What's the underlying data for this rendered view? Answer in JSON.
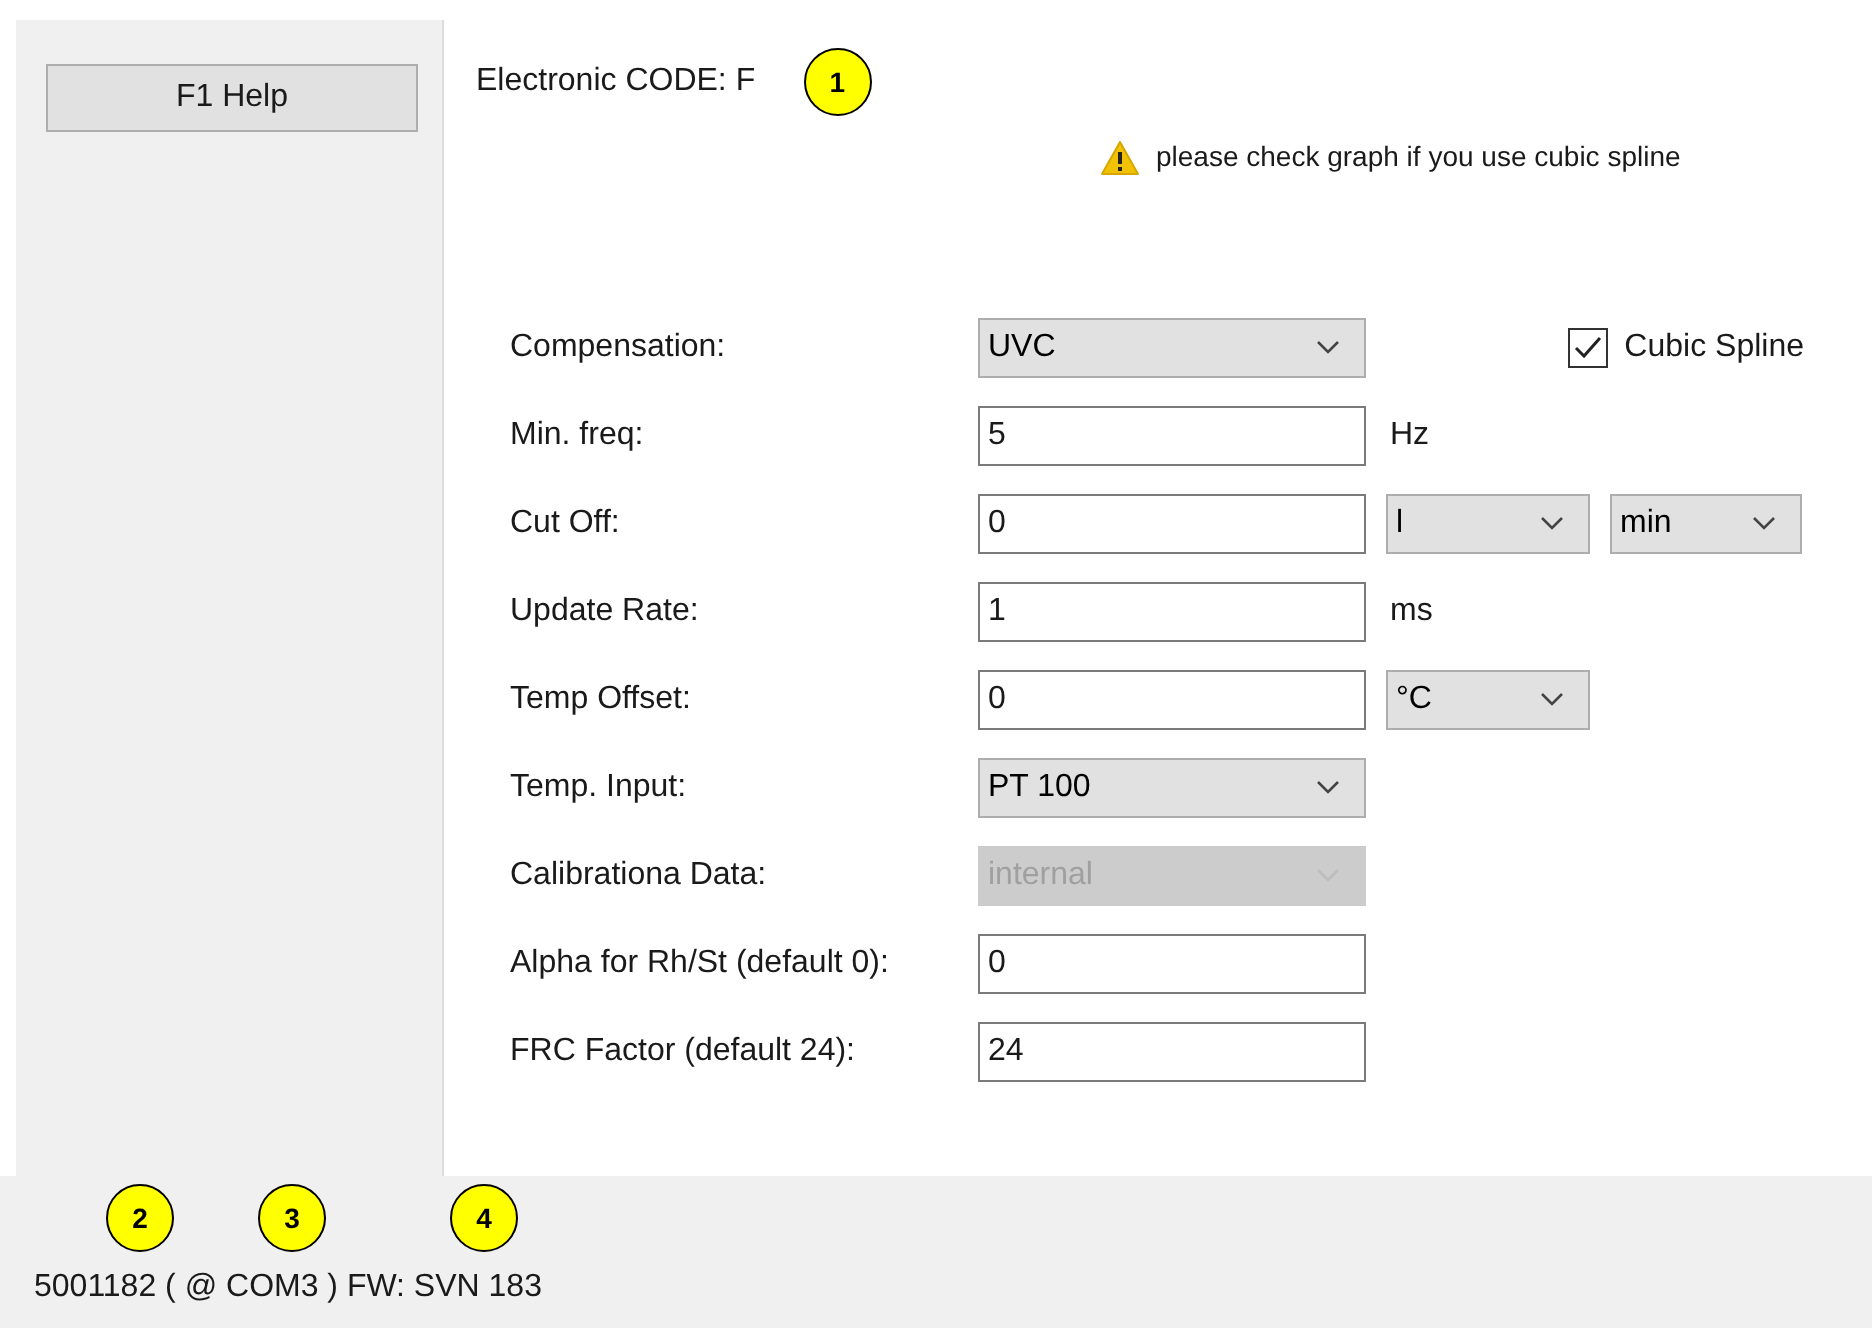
{
  "sidebar": {
    "help_button": "F1 Help"
  },
  "header": {
    "title": "Electronic CODE: F",
    "callout": "1"
  },
  "warning": {
    "text": "please check graph if you use cubic spline"
  },
  "cubic_spline": {
    "label": "Cubic Spline",
    "checked": true
  },
  "form": [
    {
      "label": "Compensation:",
      "control": {
        "kind": "select",
        "value": "UVC",
        "disabled": false
      }
    },
    {
      "label": "Min. freq:",
      "control": {
        "kind": "input",
        "value": "5"
      },
      "extras": [
        {
          "kind": "unit",
          "text": "Hz"
        }
      ]
    },
    {
      "label": "Cut Off:",
      "control": {
        "kind": "input",
        "value": "0"
      },
      "extras": [
        {
          "kind": "select",
          "text": "l"
        },
        {
          "kind": "select",
          "text": "min"
        }
      ]
    },
    {
      "label": "Update Rate:",
      "control": {
        "kind": "input",
        "value": "1"
      },
      "extras": [
        {
          "kind": "unit",
          "text": "ms"
        }
      ]
    },
    {
      "label": "Temp Offset:",
      "control": {
        "kind": "input",
        "value": "0"
      },
      "extras": [
        {
          "kind": "select",
          "text": "°C"
        }
      ]
    },
    {
      "label": "Temp. Input:",
      "control": {
        "kind": "select",
        "value": "PT 100",
        "disabled": false
      }
    },
    {
      "label": "Calibrationa Data:",
      "control": {
        "kind": "select",
        "value": "internal",
        "disabled": true
      }
    },
    {
      "label": "Alpha for Rh/St (default 0):",
      "control": {
        "kind": "input",
        "value": "0"
      }
    },
    {
      "label": "FRC Factor (default 24):",
      "control": {
        "kind": "input",
        "value": "24"
      }
    }
  ],
  "status_bar": {
    "text": "5001182 ( @ COM3 ) FW: SVN 183",
    "callouts": [
      "2",
      "3",
      "4"
    ]
  }
}
